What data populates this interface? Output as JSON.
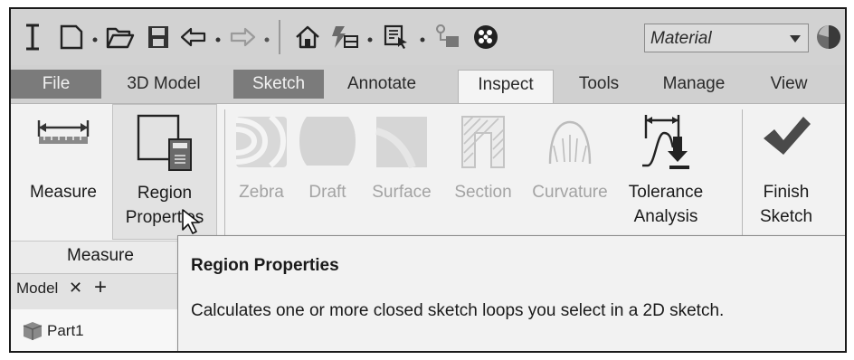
{
  "quick_access": {
    "material_value": "Material"
  },
  "tabs": [
    {
      "label": "File"
    },
    {
      "label": "3D Model"
    },
    {
      "label": "Sketch"
    },
    {
      "label": "Annotate"
    },
    {
      "label": "Inspect"
    },
    {
      "label": "Tools"
    },
    {
      "label": "Manage"
    },
    {
      "label": "View"
    }
  ],
  "ribbon": {
    "tools": [
      {
        "line1": "Measure",
        "line2": ""
      },
      {
        "line1": "Region",
        "line2": "Properties"
      },
      {
        "line1": "Zebra",
        "line2": ""
      },
      {
        "line1": "Draft",
        "line2": ""
      },
      {
        "line1": "Surface",
        "line2": ""
      },
      {
        "line1": "Section",
        "line2": ""
      },
      {
        "line1": "Curvature",
        "line2": ""
      },
      {
        "line1": "Tolerance",
        "line2": "Analysis"
      },
      {
        "line1": "Finish",
        "line2": "Sketch"
      }
    ],
    "panel_label": "Measure"
  },
  "browser": {
    "tab_label": "Model",
    "close_glyph": "✕",
    "add_glyph": "+",
    "part_label": "Part1"
  },
  "tooltip": {
    "title": "Region Properties",
    "description": "Calculates one or more closed sketch loops you select in a 2D sketch."
  },
  "colors": {
    "ribbon_bg": "#f2f2f2",
    "toolbar_bg": "#d2d2d2",
    "dark_tab_bg": "#7b7b7b",
    "checkmark": "#4a4a4a"
  }
}
